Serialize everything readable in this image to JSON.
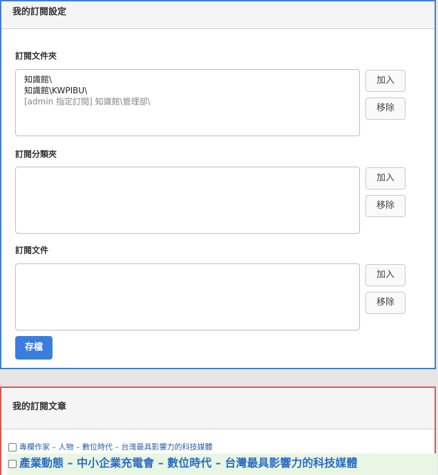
{
  "settings_panel": {
    "title": "我的訂閱設定",
    "folders": {
      "label": "訂閱文件夾",
      "items": [
        {
          "text": "知識館\\",
          "muted": false
        },
        {
          "text": "知識館\\KWPIBU\\",
          "muted": false
        },
        {
          "text": "[admin 指定訂閱] 知識館\\管理部\\",
          "muted": true
        }
      ],
      "add_label": "加入",
      "remove_label": "移除"
    },
    "categories": {
      "label": "訂閱分類夾",
      "items": [],
      "add_label": "加入",
      "remove_label": "移除"
    },
    "documents": {
      "label": "訂閱文件",
      "items": [],
      "add_label": "加入",
      "remove_label": "移除"
    },
    "save_label": "存檔"
  },
  "articles_panel": {
    "title": "我的訂閱文章",
    "articles": [
      {
        "text": "專欄作家 – 人物 – 數位時代 – 台灣最具影響力的科技媒體"
      },
      {
        "text": "產業動態 – 中小企業充電會 – 數位時代 – 台灣最具影響力的科技媒體"
      }
    ]
  },
  "colors": {
    "accent_blue": "#3b7ddd",
    "accent_red": "#e5534b",
    "link_blue": "#2a5fb0",
    "highlight_green": "#e9f6e4"
  }
}
